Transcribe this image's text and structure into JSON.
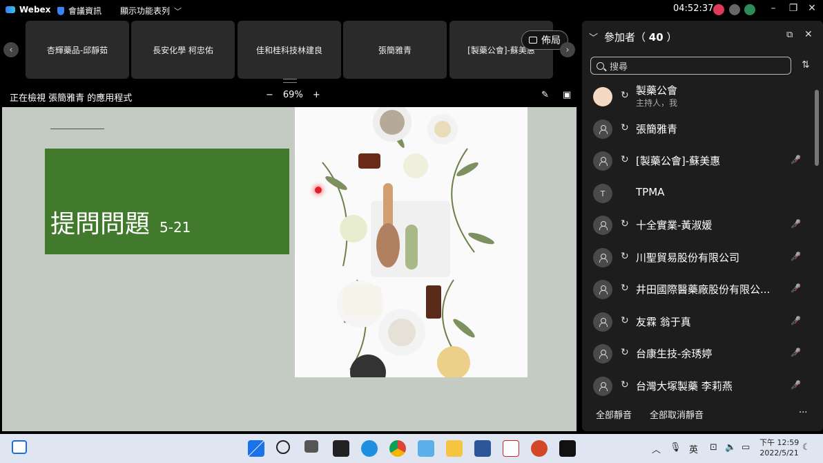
{
  "app": {
    "name": "Webex",
    "meeting_info": "會議資訊",
    "view_menu": "顯示功能表列",
    "time": "04:52:37"
  },
  "strip": {
    "tiles": [
      "杏輝藥品-邱靜茹",
      "長安化學 柯忠佑",
      "佳和桂科技林建良",
      "張簡雅青",
      "[製藥公會]-蘇美惠"
    ],
    "layout_label": "佈局"
  },
  "share": {
    "viewing_text": "正在檢視 張簡雅青 的應用程式",
    "zoom_level": "69%",
    "slide_title": "提問問題",
    "slide_subtitle": "5-21"
  },
  "panel": {
    "title": "參加者",
    "count": "40",
    "search_placeholder": "搜尋",
    "participants": [
      {
        "name": "製藥公會",
        "role": "主持人，我",
        "avatar": "host",
        "muted": false
      },
      {
        "name": "張簡雅青",
        "role": "",
        "avatar": "presenter",
        "muted": false
      },
      {
        "name": "[製藥公會]-蘇美惠",
        "role": "",
        "avatar": "person",
        "muted": true
      },
      {
        "name": "TPMA",
        "role": "",
        "avatar": "T",
        "muted": false
      },
      {
        "name": "十全實業-黃淑媛",
        "role": "",
        "avatar": "person",
        "muted": true
      },
      {
        "name": "川聖貿易股份有限公司",
        "role": "",
        "avatar": "person",
        "muted": true
      },
      {
        "name": "井田國際醫藥廠股份有限公...",
        "role": "",
        "avatar": "person",
        "muted": true
      },
      {
        "name": "友霖 翁于真",
        "role": "",
        "avatar": "person",
        "muted": true
      },
      {
        "name": "台康生技-余琇婷",
        "role": "",
        "avatar": "person",
        "muted": true
      },
      {
        "name": "台灣大塚製藥 李莉燕",
        "role": "",
        "avatar": "person",
        "muted": true
      }
    ],
    "mute_all": "全部靜音",
    "unmute_all": "全部取消靜音",
    "more": "···"
  },
  "taskbar": {
    "ime": "英",
    "clock_time": "下午 12:59",
    "clock_date": "2022/5/21"
  },
  "colors": {
    "accent": "#417a2d",
    "share_bg": "#c3cbc3",
    "taskbar": "#dfe6f2",
    "mute_red": "#e0505a"
  }
}
